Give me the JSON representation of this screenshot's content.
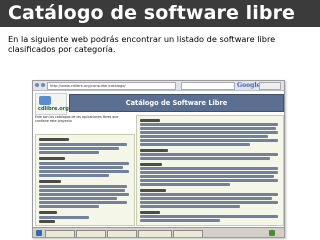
{
  "slide": {
    "title": "Catálogo de software libre",
    "intro": "En la siguiente web podrás encontrar un listado de software libre clasificados por categoría."
  },
  "screenshot": {
    "address_bar": "http://www.cdlibre.org/consultar/catalogo/",
    "search_logo": "Google",
    "site_logo_text": "cdlibre.org",
    "page_header": "Catálogo de Software Libre",
    "description": "Este son los catálogos de las aplicaciones libres que contiene este proyecto"
  },
  "colors": {
    "banner": "#3b3b3b",
    "header_bar": "#5b6f92",
    "column_bg": "#f4f6e8"
  }
}
